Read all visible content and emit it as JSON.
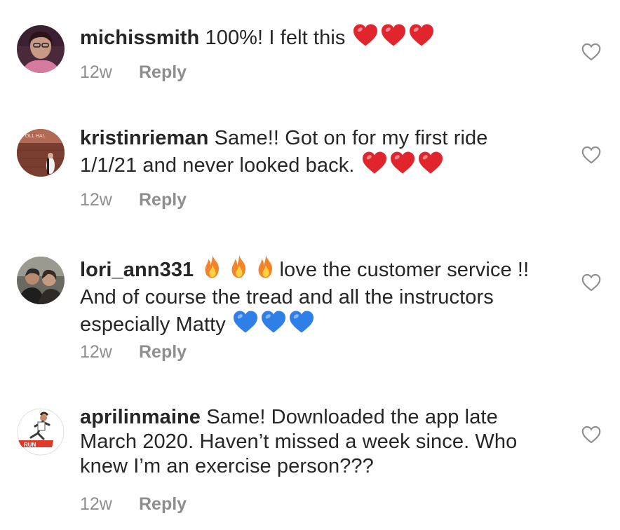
{
  "comments": [
    {
      "username": "michissmith",
      "segments": [
        {
          "type": "text",
          "value": " 100%! I felt this "
        },
        {
          "type": "emoji",
          "name": "red-heart"
        },
        {
          "type": "emoji",
          "name": "red-heart"
        },
        {
          "type": "emoji",
          "name": "red-heart"
        }
      ],
      "age": "12w",
      "reply_label": "Reply"
    },
    {
      "username": "kristinrieman",
      "segments": [
        {
          "type": "text",
          "value": " Same!! Got on for my first ride 1/1/21 and never looked back. "
        },
        {
          "type": "emoji",
          "name": "red-heart"
        },
        {
          "type": "emoji",
          "name": "red-heart"
        },
        {
          "type": "emoji",
          "name": "red-heart"
        }
      ],
      "age": "12w",
      "reply_label": "Reply"
    },
    {
      "username": "lori_ann331",
      "segments": [
        {
          "type": "text",
          "value": " "
        },
        {
          "type": "emoji",
          "name": "fire"
        },
        {
          "type": "emoji",
          "name": "fire"
        },
        {
          "type": "emoji",
          "name": "fire"
        },
        {
          "type": "text",
          "value": "love the customer service !! And of course the tread and all the instructors especially Matty "
        },
        {
          "type": "emoji",
          "name": "blue-heart"
        },
        {
          "type": "emoji",
          "name": "blue-heart"
        },
        {
          "type": "emoji",
          "name": "blue-heart"
        }
      ],
      "age": "12w",
      "reply_label": "Reply"
    },
    {
      "username": "aprilinmaine",
      "segments": [
        {
          "type": "text",
          "value": " Same! Downloaded the app late March 2020. Haven’t missed a week since. Who knew I’m an exercise person???"
        }
      ],
      "age": "12w",
      "reply_label": "Reply"
    }
  ],
  "icons": {
    "like": "heart-outline-icon",
    "red_heart": "red-heart-emoji",
    "blue_heart": "blue-heart-emoji",
    "fire": "fire-emoji"
  },
  "colors": {
    "text": "#262626",
    "meta": "#8e8e8e",
    "red_heart": "#e0252c",
    "blue_heart": "#2f7fe8",
    "fire": "#f5832a"
  }
}
